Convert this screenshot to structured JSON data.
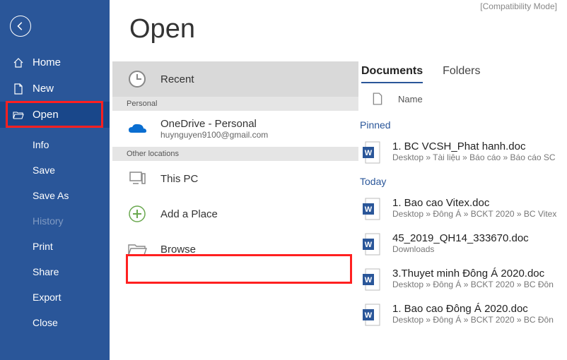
{
  "titlebar_fragment": "[Compatibility Mode]",
  "sidebar": {
    "nav": [
      {
        "label": "Home"
      },
      {
        "label": "New"
      },
      {
        "label": "Open"
      }
    ],
    "sub": [
      {
        "label": "Info"
      },
      {
        "label": "Save"
      },
      {
        "label": "Save As"
      },
      {
        "label": "History",
        "disabled": true
      },
      {
        "label": "Print"
      },
      {
        "label": "Share"
      },
      {
        "label": "Export"
      },
      {
        "label": "Close"
      }
    ]
  },
  "page_title": "Open",
  "locations": {
    "recent": "Recent",
    "personal_header": "Personal",
    "onedrive": {
      "title": "OneDrive - Personal",
      "sub": "huynguyen9100@gmail.com"
    },
    "other_header": "Other locations",
    "thispc": "This PC",
    "addplace": "Add a Place",
    "browse": "Browse"
  },
  "tabs": {
    "documents": "Documents",
    "folders": "Folders"
  },
  "list_header_name": "Name",
  "groups": {
    "pinned": "Pinned",
    "today": "Today"
  },
  "files": {
    "pinned": [
      {
        "name": "1. BC VCSH_Phat hanh.doc",
        "path": "Desktop » Tài liệu » Báo cáo » Báo cáo SC"
      }
    ],
    "today": [
      {
        "name": "1. Bao cao Vitex.doc",
        "path": "Desktop » Đông Á » BCKT 2020 » BC Vitex"
      },
      {
        "name": "45_2019_QH14_333670.doc",
        "path": "Downloads"
      },
      {
        "name": "3.Thuyet minh Đông Á 2020.doc",
        "path": "Desktop » Đông Á » BCKT 2020 » BC Đôn"
      },
      {
        "name": "1. Bao cao Đông Á 2020.doc",
        "path": "Desktop » Đông Á » BCKT 2020 » BC Đôn"
      }
    ]
  }
}
